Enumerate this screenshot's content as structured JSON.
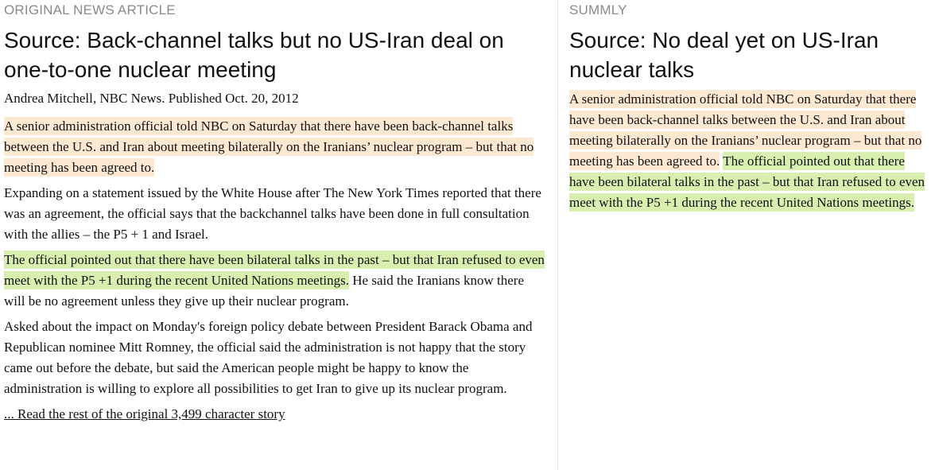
{
  "original": {
    "section_label": "ORIGINAL NEWS ARTICLE",
    "headline": "Source: Back-channel talks but no US-Iran deal on one-to-one nuclear meeting",
    "byline": "Andrea Mitchell, NBC News. Published Oct. 20, 2012",
    "p1_highlight": "A senior administration official told NBC on Saturday that there have been back-channel talks between the U.S. and Iran about meeting bilaterally on the Iranians’ nuclear program – but that no meeting has been agreed to.",
    "p2": "Expanding on a statement issued by the White House after The New York Times reported that there was an agreement, the official says that the backchannel talks have been done in full consultation with the allies – the P5 + 1 and Israel.",
    "p3_highlight": "The official pointed out that there have been bilateral talks in the past – but that Iran refused to even meet with the P5 +1 during the recent United Nations meetings.",
    "p3_rest": " He said the Iranians know there will be no agreement unless they give up their nuclear program.",
    "p4": "Asked about the impact on Monday's foreign policy debate between President Barack Obama and Republican nominee Mitt Romney, the official said the administration is not happy that the story came out before the debate, but said the American people might be happy to know the administration is willing to explore all possibilities to get Iran to give up its nuclear program.",
    "read_more": "... Read the rest of the original 3,499 character story"
  },
  "summly": {
    "section_label": "SUMMLY",
    "headline": "Source: No deal yet on US-Iran nuclear talks",
    "s1_highlight": "A senior administration official told NBC on Saturday that there have been back-channel talks between the U.S. and Iran about meeting bilaterally on the Iranians’ nuclear program – but that no meeting has been agreed to.",
    "s2_highlight": "The official pointed out that there have been bilateral talks in the past – but that Iran refused to even meet with the P5 +1 during the recent United Nations meetings."
  },
  "colors": {
    "highlight_orange": "#fde8d2",
    "highlight_green": "#d8efb0",
    "label_gray": "#8a8a8a",
    "text": "#111111"
  }
}
